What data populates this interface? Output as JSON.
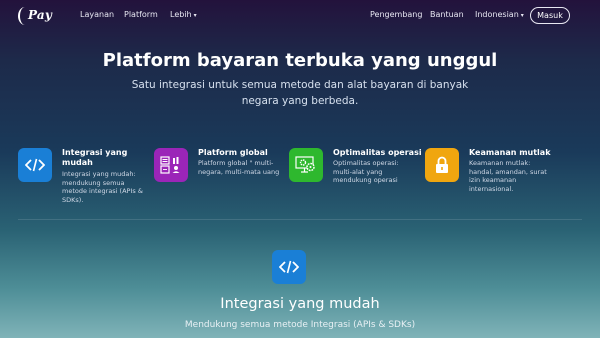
{
  "nav": {
    "brand": "Pay",
    "links_left": [
      "Layanan",
      "Platform",
      "Lebih"
    ],
    "links_right": [
      "Pengembang",
      "Bantuan",
      "Indonesian"
    ],
    "login": "Masuk"
  },
  "hero": {
    "title": "Platform bayaran terbuka yang unggul",
    "subtitle": "Satu integrasi untuk semua metode dan alat bayaran di banyak negara yang berbeda."
  },
  "features": [
    {
      "title": "Integrasi yang mudah",
      "desc": "Integrasi yang mudah: mendukung semua metode integrasi (APIs & SDKs).",
      "icon": "code-icon",
      "color": "#1a7fd6"
    },
    {
      "title": "Platform global",
      "desc": "Platform global \" multi-negara, multi-mata uang",
      "icon": "calculator-icon",
      "color": "#9b25b8"
    },
    {
      "title": "Optimalitas operasi",
      "desc": "Optimalitas operasi: multi-alat yang mendukung operasi",
      "icon": "gears-icon",
      "color": "#2eb82e"
    },
    {
      "title": "Keamanan mutlak",
      "desc": "Keamanan mutlak: handal, amandan, surat izin keamanan internasional.",
      "icon": "lock-icon",
      "color": "#f0a60f"
    }
  ],
  "section": {
    "title": "Integrasi yang mudah",
    "subtitle": "Mendukung semua metode Integrasi (APIs & SDKs)",
    "icon": "code-icon"
  }
}
